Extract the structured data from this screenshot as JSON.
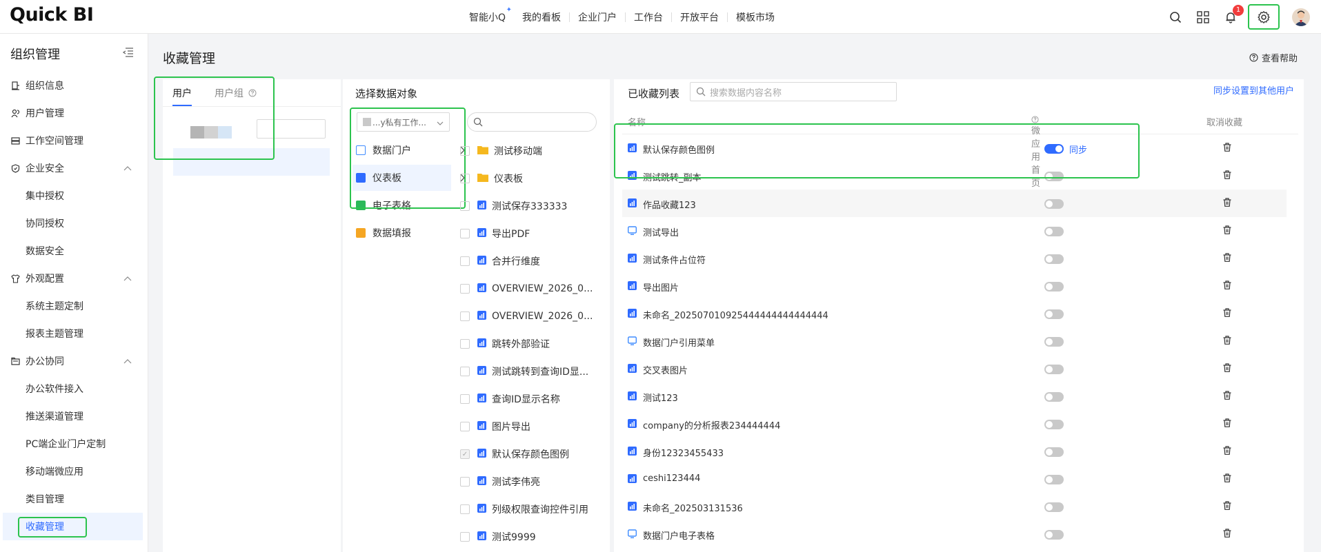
{
  "header": {
    "logo": "Quick BI",
    "nav": [
      "智能小Q",
      "我的看板",
      "企业门户",
      "工作台",
      "开放平台",
      "模板市场"
    ],
    "notification_count": "1",
    "icons": [
      "search-icon",
      "apps-grid-icon",
      "bell-icon",
      "gear-icon"
    ]
  },
  "sidebar": {
    "title": "组织管理",
    "items": [
      {
        "label": "组织信息",
        "type": "item",
        "icon": "org-info-icon"
      },
      {
        "label": "用户管理",
        "type": "item",
        "icon": "users-icon"
      },
      {
        "label": "工作空间管理",
        "type": "item",
        "icon": "workspace-icon"
      },
      {
        "label": "企业安全",
        "type": "group",
        "icon": "shield-icon"
      },
      {
        "label": "集中授权",
        "type": "sub"
      },
      {
        "label": "协同授权",
        "type": "sub"
      },
      {
        "label": "数据安全",
        "type": "sub"
      },
      {
        "label": "外观配置",
        "type": "group",
        "icon": "shirt-icon"
      },
      {
        "label": "系统主题定制",
        "type": "sub"
      },
      {
        "label": "报表主题管理",
        "type": "sub"
      },
      {
        "label": "办公协同",
        "type": "group",
        "icon": "office-icon"
      },
      {
        "label": "办公软件接入",
        "type": "sub"
      },
      {
        "label": "推送渠道管理",
        "type": "sub"
      },
      {
        "label": "PC端企业门户定制",
        "type": "sub"
      },
      {
        "label": "移动端微应用",
        "type": "sub"
      },
      {
        "label": "类目管理",
        "type": "sub"
      },
      {
        "label": "收藏管理",
        "type": "sub",
        "active": true
      },
      {
        "label": "...",
        "type": "group",
        "icon": "settings-icon"
      }
    ]
  },
  "main": {
    "title": "收藏管理",
    "help": "查看帮助",
    "users_panel": {
      "tabs": [
        "用户",
        "用户组"
      ]
    },
    "objects_panel": {
      "title": "选择数据对象",
      "workspace_select": "...y私有工作...",
      "categories": [
        {
          "label": "数据门户",
          "color": "#3f8cff",
          "has_arrow": true
        },
        {
          "label": "仪表板",
          "color": "#2f6bff",
          "has_arrow": true,
          "selected": true
        },
        {
          "label": "电子表格",
          "color": "#2bb95a",
          "has_arrow": false
        },
        {
          "label": "数据填报",
          "color": "#f5a623",
          "has_arrow": false
        }
      ],
      "objects": [
        {
          "label": "测试移动端",
          "kind": "folder",
          "checked": false
        },
        {
          "label": "仪表板",
          "kind": "folder",
          "checked": false
        },
        {
          "label": "测试保存333333",
          "kind": "dashboard",
          "checked": false
        },
        {
          "label": "导出PDF",
          "kind": "dashboard",
          "checked": false
        },
        {
          "label": "合并行维度",
          "kind": "dashboard",
          "checked": false
        },
        {
          "label": "OVERVIEW_2026_0...",
          "kind": "dashboard",
          "checked": false
        },
        {
          "label": "OVERVIEW_2026_0...",
          "kind": "dashboard",
          "checked": false
        },
        {
          "label": "跳转外部验证",
          "kind": "dashboard",
          "checked": false
        },
        {
          "label": "测试跳转到查询ID显...",
          "kind": "dashboard",
          "checked": false
        },
        {
          "label": "查询ID显示名称",
          "kind": "dashboard",
          "checked": false
        },
        {
          "label": "图片导出",
          "kind": "dashboard",
          "checked": false
        },
        {
          "label": "默认保存颜色图例",
          "kind": "dashboard",
          "checked": true
        },
        {
          "label": "测试李伟亮",
          "kind": "dashboard",
          "checked": false
        },
        {
          "label": "列级权限查询控件引用",
          "kind": "dashboard",
          "checked": false
        },
        {
          "label": "测试9999",
          "kind": "dashboard",
          "checked": false
        }
      ]
    },
    "favorites_panel": {
      "title": "已收藏列表",
      "search_placeholder": "搜索数据内容名称",
      "sync_link": "同步设置到其他用户",
      "columns": [
        "名称",
        "微应用首页",
        "取消收藏"
      ],
      "sync_label": "同步",
      "rows": [
        {
          "name": "默认保存颜色图例",
          "kind": "dashboard",
          "on": true
        },
        {
          "name": "测试跳转_副本",
          "kind": "dashboard",
          "on": false
        },
        {
          "name": "作品收藏123",
          "kind": "dashboard",
          "on": false
        },
        {
          "name": "测试导出",
          "kind": "portal",
          "on": false
        },
        {
          "name": "测试条件占位符",
          "kind": "dashboard",
          "on": false
        },
        {
          "name": "导出图片",
          "kind": "dashboard",
          "on": false
        },
        {
          "name": "未命名_202507010925444444444444444",
          "kind": "dashboard",
          "on": false
        },
        {
          "name": "数据门户引用菜单",
          "kind": "portal",
          "on": false
        },
        {
          "name": "交叉表图片",
          "kind": "dashboard",
          "on": false
        },
        {
          "name": "测试123",
          "kind": "dashboard",
          "on": false
        },
        {
          "name": "company的分析报表234444444",
          "kind": "dashboard",
          "on": false
        },
        {
          "name": "身份12323455433",
          "kind": "dashboard",
          "on": false
        },
        {
          "name": "ceshi123444",
          "kind": "dashboard",
          "on": false
        },
        {
          "name": "未命名_202503131536",
          "kind": "dashboard",
          "on": false
        },
        {
          "name": "数据门户电子表格",
          "kind": "portal",
          "on": false
        }
      ]
    }
  },
  "colors": {
    "accent": "#2f6bff",
    "highlight_box": "#2bc34d",
    "badge": "#f23c3c"
  }
}
